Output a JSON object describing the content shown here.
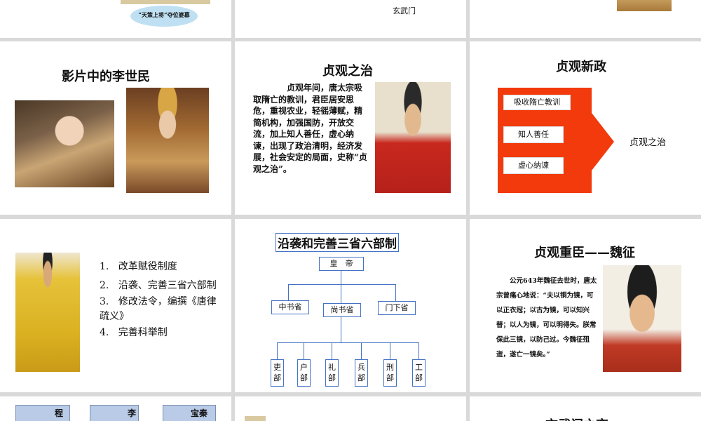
{
  "row1": {
    "left_caption": "“天策上将”夺位婆慕",
    "mid_caption": "玄武门"
  },
  "film": {
    "title": "影片中的李世民"
  },
  "zhenguan": {
    "title": "贞观之治",
    "body": "贞观年间，唐太宗吸取隋亡的教训，君臣居安思危，重视农业，轻徭薄赋，精简机构，加强国防，开放交流，加上知人善任，虚心纳谏，出现了政治清明，经济发展，社会安定的局面，史称“贞观之治”。"
  },
  "xinzheng": {
    "title": "贞观新政",
    "items": [
      "吸收隋亡教训",
      "知人善任",
      "虚心纳谏"
    ],
    "result": "贞观之治",
    "arrow_color": "#f23a0c"
  },
  "reforms": {
    "items": [
      {
        "num": "1.",
        "text": "改革赋役制度"
      },
      {
        "num": "2.",
        "text": "沿袭、完善三省六部制"
      },
      {
        "num": "3.",
        "text": "修改法令，编撰《唐律疏义》"
      },
      {
        "num": "4.",
        "text": "完善科举制"
      }
    ]
  },
  "sansheng": {
    "title": "沿袭和完善三省六部制",
    "emperor": "皇　帝",
    "provinces": [
      "中书省",
      "尚书省",
      "门下省"
    ],
    "ministries": [
      "吏部",
      "户部",
      "礼部",
      "兵部",
      "刑部",
      "工部"
    ],
    "line_color": "#4472c4"
  },
  "weizheng": {
    "title": "贞观重臣——魏征",
    "body": "公元643年魏征去世时，唐太宗曾痛心地说：“夫以铜为镜，可以正衣冠；以古为镜，可以知兴替；以人为镜，可以明得失。朕常保此三镜，以防己过。今魏征殂逝，遂亡一镜矣。”"
  },
  "row4": {
    "portrait_labels": [
      "程",
      "李",
      "宝秦"
    ],
    "right_title_partial": "玄武门之变"
  }
}
